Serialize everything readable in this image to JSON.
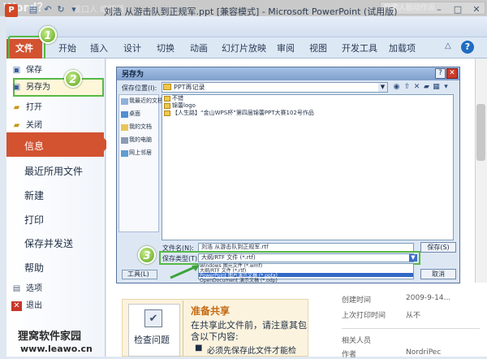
{
  "background_page": {
    "title_fragment": "Word？",
    "subtitle_fragment": "发口人 编辑器",
    "search_placeholder": "搜索人脸动作设"
  },
  "window": {
    "title": "刘浩 从游击队到正规军.ppt [兼容模式] - Microsoft PowerPoint (试用版)",
    "app_icon": "P",
    "minimize": "–",
    "maximize": "□",
    "close": "✕"
  },
  "ribbon": {
    "file_tab": "文件",
    "tabs": [
      "开始",
      "插入",
      "设计",
      "切换",
      "动画",
      "幻灯片放映",
      "审阅",
      "视图",
      "开发工具",
      "加载项"
    ],
    "help": "?"
  },
  "backstage": {
    "save": "保存",
    "save_as": "另存为",
    "open": "打开",
    "close": "关闭",
    "info": "信息",
    "recent": "最近所用文件",
    "new": "新建",
    "print": "打印",
    "save_send": "保存并发送",
    "help": "帮助",
    "options": "选项",
    "exit": "退出"
  },
  "dialog": {
    "title": "另存为",
    "save_in_label": "保存位置(I):",
    "save_in_value": "PPT再记录",
    "places": [
      "我最近的文档",
      "桌面",
      "我的文档",
      "我的电脑",
      "网上邻居"
    ],
    "files": [
      "不错",
      "锦蕾logo",
      "【人生路】“金山WPS杯”第四届锦蕾PPT大赛102号作品"
    ],
    "filename_label": "文件名(N):",
    "filename_value": "刘浩 从游击队到正规军.rtf",
    "filetype_label": "保存类型(T):",
    "filetype_value": "大纲/RTF 文件 (*.rtf)",
    "filetype_options": [
      "Windows 图元文件 (*.wmf)",
      "大纲/RTF 文件 (*.rtf)",
      "PowerPoint 图片演示文稿 (*.pptx)",
      "OpenDocument 演示文稿 (*.odp)"
    ],
    "tools": "工具(L)",
    "save_button": "保存(S)",
    "cancel_button": "取消"
  },
  "info_panel": {
    "prepare_title": "准备共享",
    "prepare_desc1": "在共享此文件前，请注意其包",
    "prepare_desc2": "含以下内容:",
    "prepare_bullet": "必须先保存此文件才能检",
    "inspect_label": "检查问题",
    "created_label": "创建时间",
    "created_value": "2009-9-14...",
    "printed_label": "上次打印时间",
    "printed_value": "从不",
    "related_people": "相关人员",
    "author_label": "作者",
    "author_value": "NordriPec"
  },
  "watermark": {
    "line1": "狸窝软件家园",
    "line2": "www.leawo.cn"
  },
  "badges": [
    "1",
    "2",
    "3"
  ],
  "colors": {
    "file_tab": "#d35230",
    "highlight": "#57b846",
    "dialog_title": "#7f9fcb"
  }
}
